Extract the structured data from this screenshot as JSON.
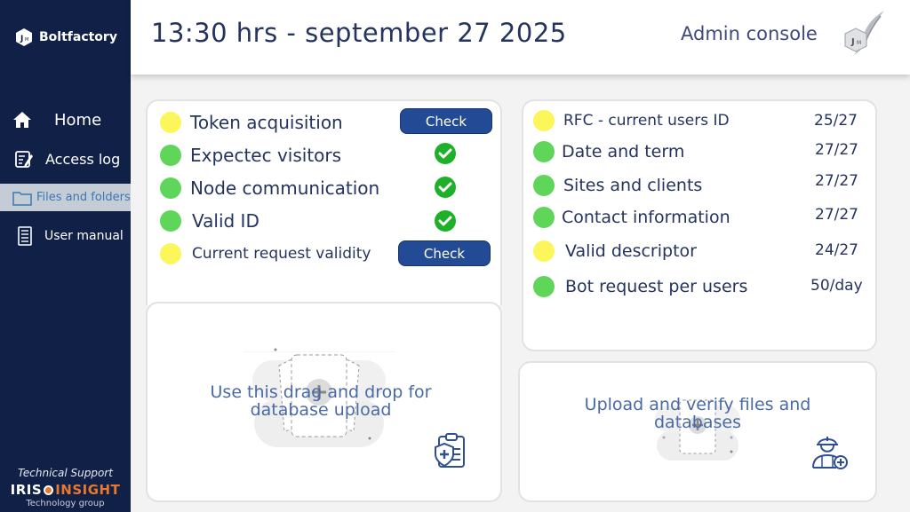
{
  "sidebar": {
    "brand_name": "Boltfactory",
    "items": [
      {
        "label": "Home",
        "icon": "home-icon"
      },
      {
        "label": "Access log",
        "icon": "edit-log-icon"
      },
      {
        "label": "Files and folders",
        "icon": "folder-icon",
        "active": true
      },
      {
        "label": "User manual",
        "icon": "manual-icon"
      }
    ],
    "support_title": "Technical Support",
    "support_brand_left": "IRIS",
    "support_brand_right": "INSIGHT",
    "support_sub": "Technology group"
  },
  "header": {
    "datetime": "13:30 hrs - september 27 2025",
    "console_label": "Admin console"
  },
  "checks": {
    "rows": [
      {
        "label": "Token acquisition",
        "status": "yellow",
        "action": "Check"
      },
      {
        "label": "Expectec visitors",
        "status": "green",
        "action": "ok"
      },
      {
        "label": "Node communication",
        "status": "green",
        "action": "ok"
      },
      {
        "label": "Valid ID",
        "status": "green",
        "action": "ok"
      },
      {
        "label": "Current request validity",
        "status": "yellow",
        "action": "Check"
      }
    ],
    "check_label": "Check"
  },
  "stats": {
    "rows": [
      {
        "label": "RFC - current users ID",
        "status": "yellow",
        "value": "25/27"
      },
      {
        "label": "Date and term",
        "status": "green",
        "value": "27/27"
      },
      {
        "label": "Sites and clients",
        "status": "green",
        "value": "27/27"
      },
      {
        "label": "Contact information",
        "status": "green",
        "value": "27/27"
      },
      {
        "label": "Valid descriptor",
        "status": "yellow",
        "value": "24/27"
      },
      {
        "label": "Bot request per users",
        "status": "green",
        "value": "50/day"
      }
    ]
  },
  "upload_db": {
    "text": "Use this drag and drop for database upload",
    "icon": "medical-clipboard-icon"
  },
  "upload_verify": {
    "text": "Upload and verify files and databases",
    "icon": "worker-add-icon"
  },
  "colors": {
    "sidebar": "#102047",
    "accent_button": "#234a94",
    "status_green": "#5fd65a",
    "status_yellow": "#fbf65a",
    "ok_check": "#1fb02a",
    "active_nav": "#c4ccd6"
  }
}
